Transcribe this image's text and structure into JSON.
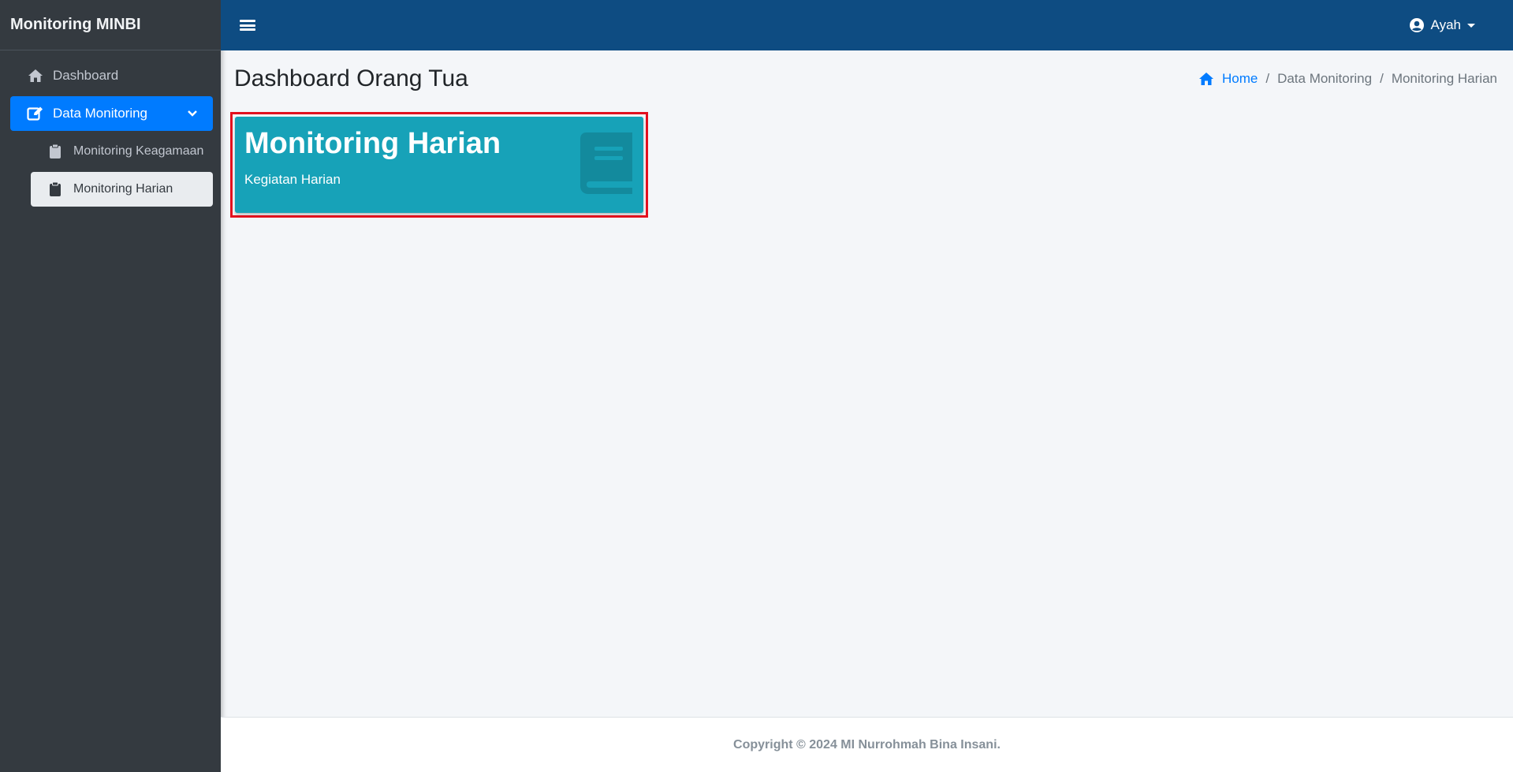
{
  "brand": {
    "title": "Monitoring MINBI"
  },
  "sidebar": {
    "items": [
      {
        "label": "Dashboard",
        "icon": "home-icon"
      },
      {
        "label": "Data Monitoring",
        "icon": "edit-icon",
        "active": true
      }
    ],
    "subitems": [
      {
        "label": "Monitoring Keagamaan",
        "icon": "clipboard-icon"
      },
      {
        "label": "Monitoring Harian",
        "icon": "clipboard-icon",
        "current": true
      }
    ]
  },
  "topbar": {
    "user_name": "Ayah",
    "color": "#0e4c82"
  },
  "content": {
    "page_title": "Dashboard Orang Tua",
    "breadcrumb": [
      "Home",
      "Data Monitoring",
      "Monitoring Harian"
    ]
  },
  "info_box": {
    "title": "Monitoring Harian",
    "subtitle": "Kegiatan Harian",
    "icon": "book-icon",
    "color": "#17a2b8"
  },
  "footer": {
    "text": "Copyright © 2024 MI Nurrohmah Bina Insani."
  },
  "colors": {
    "sidebar_bg": "#343a40",
    "accent": "#007bff",
    "highlight": "#e3101e"
  }
}
